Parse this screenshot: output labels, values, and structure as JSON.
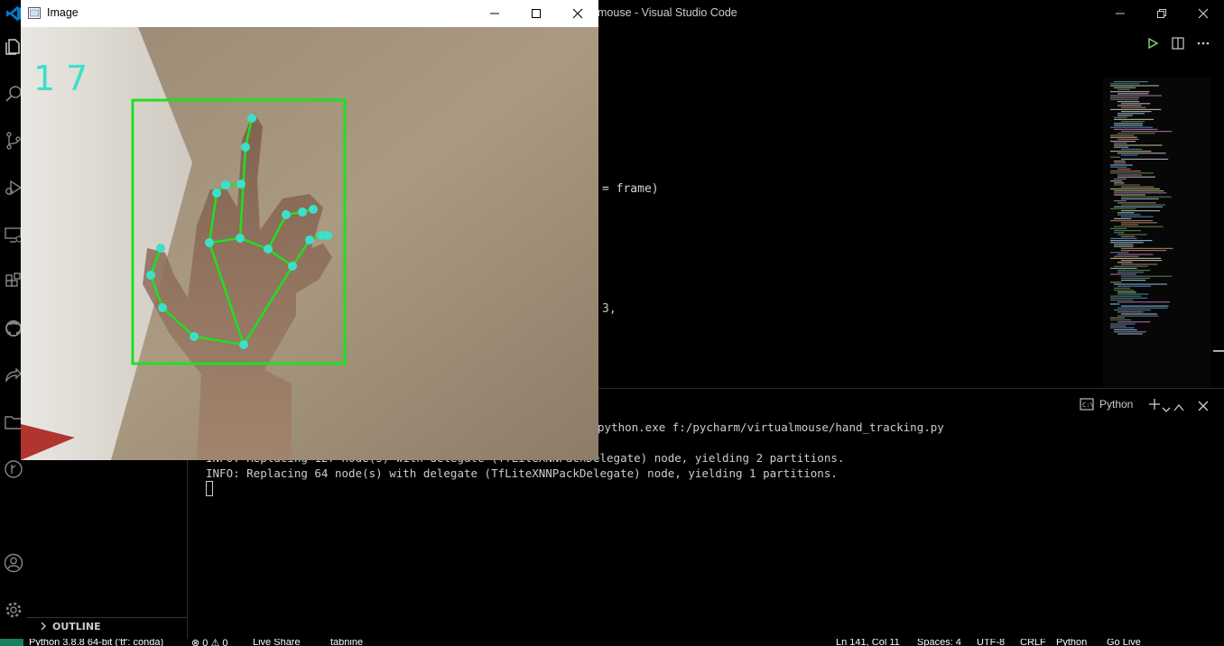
{
  "vscode": {
    "title": "mouse - Visual Studio Code",
    "editor_fragments": {
      "line_a": "= frame)",
      "line_b": "3,"
    },
    "panel": {
      "terminal_name": "Python",
      "command_fragment": "python.exe f:/pycharm/virtualmouse/hand_tracking.py",
      "lines": [
        "INFO: Replacing 127 node(s) with delegate (TfLiteXNNPackDelegate) node, yielding 2 partitions.",
        "INFO: Replacing 64 node(s) with delegate (TfLiteXNNPackDelegate) node, yielding 1 partitions."
      ]
    },
    "sidebar": {
      "outline_label": "OUTLINE"
    },
    "statusbar": {
      "python": "Python 3.8.8 64-bit ('tf': conda)",
      "problems": "⊗ 0 ⚠ 0",
      "liveshare": "Live Share",
      "tabnine": "tabnine",
      "position": "Ln 141, Col 11",
      "spaces": "Spaces: 4",
      "encoding": "UTF-8",
      "eol": "CRLF",
      "language": "Python",
      "golive": "Go Live"
    },
    "activity_icons": [
      "explorer-icon",
      "search-icon",
      "source-control-icon",
      "run-debug-icon",
      "remote-explorer-icon",
      "extensions-icon",
      "github-icon",
      "live-share-icon",
      "folder-icon",
      "git-graph-icon"
    ],
    "colors": {
      "accent_vscode": "#007acc"
    }
  },
  "cv_window": {
    "title": "Image",
    "fps_text": "17",
    "colors": {
      "landmark": "#3ddfc8",
      "connection": "#1fe01f",
      "bbox": "#1fe01f",
      "fps": "#3ddfc8"
    }
  }
}
